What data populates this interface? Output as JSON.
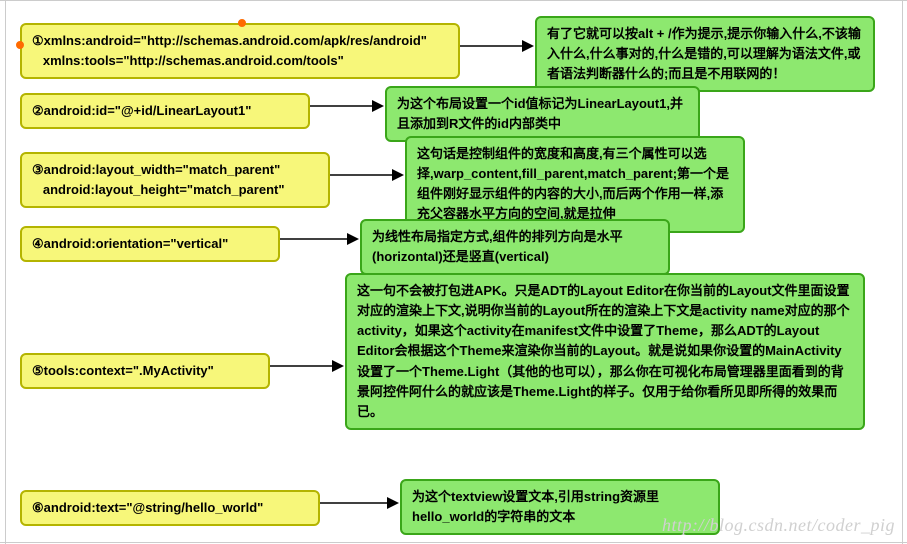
{
  "items": [
    {
      "code": "①xmlns:android=\"http://schemas.android.com/apk/res/android\"\n   xmlns:tools=\"http://schemas.android.com/tools\"",
      "note": "有了它就可以按alt + /作为提示,提示你输入什么,不该输入什么,什么事对的,什么是错的,可以理解为语法文件,或者语法判断器什么的;而且是不用联网的！"
    },
    {
      "code": "②android:id=\"@+id/LinearLayout1\"",
      "note": "为这个布局设置一个id值标记为LinearLayout1,并且添加到R文件的id内部类中"
    },
    {
      "code": "③android:layout_width=\"match_parent\"\n   android:layout_height=\"match_parent\"",
      "note": "这句话是控制组件的宽度和高度,有三个属性可以选择,warp_content,fill_parent,match_parent;第一个是组件刚好显示组件的内容的大小,而后两个作用一样,添充父容器水平方向的空间,就是拉伸"
    },
    {
      "code": "④android:orientation=\"vertical\"",
      "note": "为线性布局指定方式,组件的排列方向是水平(horizontal)还是竖直(vertical)"
    },
    {
      "code": "⑤tools:context=\".MyActivity\"",
      "note": "这一句不会被打包进APK。只是ADT的Layout Editor在你当前的Layout文件里面设置对应的渲染上下文,说明你当前的Layout所在的渲染上下文是activity name对应的那个activity，如果这个activity在manifest文件中设置了Theme，那么ADT的Layout Editor会根据这个Theme来渲染你当前的Layout。就是说如果你设置的MainActivity设置了一个Theme.Light（其他的也可以），那么你在可视化布局管理器里面看到的背景阿控件阿什么的就应该是Theme.Light的样子。仅用于给你看所见即所得的效果而已。"
    },
    {
      "code": "⑥android:text=\"@string/hello_world\"",
      "note": "为这个textview设置文本,引用string资源里hello_world的字符串的文本"
    }
  ],
  "watermark": "http://blog.csdn.net/coder_pig"
}
